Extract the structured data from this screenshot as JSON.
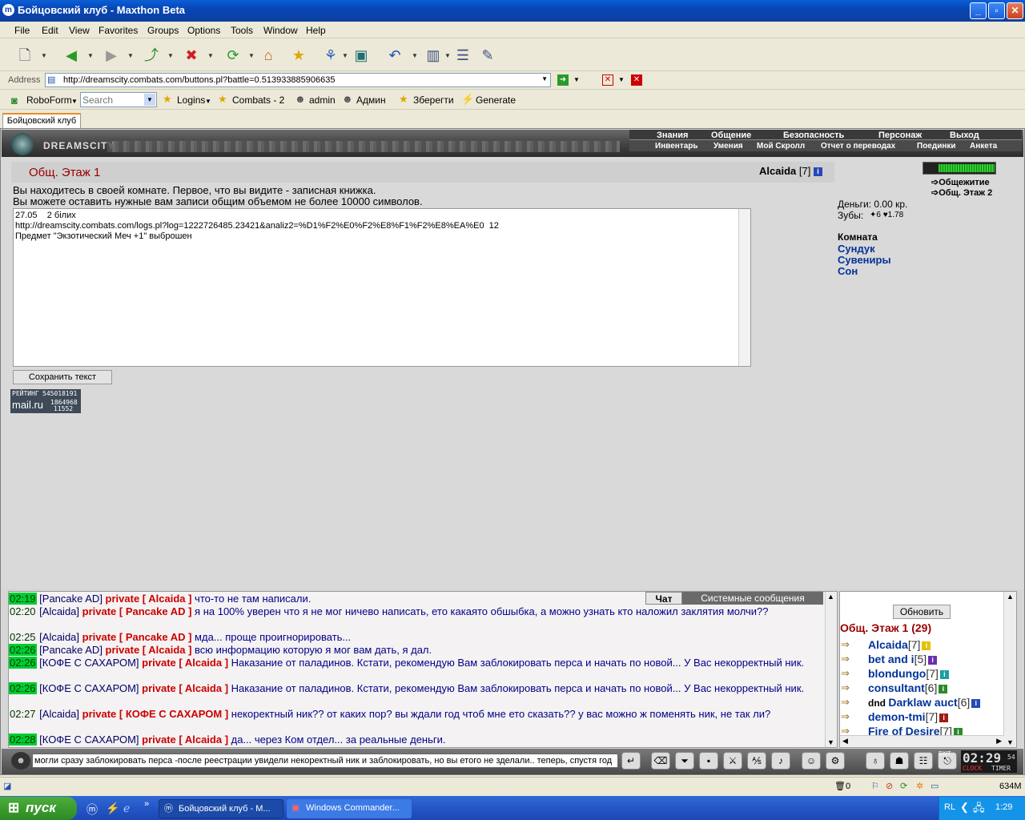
{
  "window": {
    "title": "Бойцовский клуб - Maxthon Beta"
  },
  "menu": [
    "File",
    "Edit",
    "View",
    "Favorites",
    "Groups",
    "Options",
    "Tools",
    "Window",
    "Help"
  ],
  "address": {
    "label": "Address",
    "url": "http://dreamscity.combats.com/buttons.pl?battle=0.513933885906635"
  },
  "links": {
    "roboform": "RoboForm",
    "search_placeholder": "Search",
    "logins": "Logins",
    "combats": "Combats - 2",
    "admin": "admin",
    "admin_ru": "Админ",
    "save": "Зберегти",
    "generate": "Generate"
  },
  "tab": {
    "label": "Бойцовский клуб"
  },
  "site": {
    "logo": "DREAMSCITY",
    "nav_top": [
      "Знания",
      "Общение",
      "Безопасность",
      "Персонаж",
      "Выход"
    ],
    "nav_bottom": [
      "Инвентарь",
      "Умения",
      "Мой Скролл",
      "Отчет о переводах",
      "Поединки",
      "Анкета"
    ]
  },
  "room": {
    "title": "Общ. Этаж 1",
    "user": "Alcaida",
    "level": "[7]",
    "intro1": "Вы находитесь в своей комнате. Первое, что вы видите - записная книжка.",
    "intro2": "Вы можете оставить нужные вам записи общим объемом не более 10000 символов.",
    "notes": "27.05    2 білих\nhttp://dreamscity.combats.com/logs.pl?log=1222726485.23421&analiz2=%D1%F2%E0%F2%E8%F1%F2%E8%EA%E0  12\nПредмет \"Экзотический Меч +1\" выброшен",
    "save_button": "Сохранить текст",
    "rating_label": "РЕЙТИНГ",
    "rating_id": "545018191",
    "rating_brand": "mail.ru",
    "rating_n1": "1864968",
    "rating_n2": "11552"
  },
  "sidebar": {
    "links": [
      "Общежитие",
      "Общ. Этаж 2"
    ],
    "money": "Деньги: 0.00 кр.",
    "teeth_label": "Зубы:",
    "teeth_v1": "6",
    "teeth_v2": "1.78",
    "section": "Комната",
    "room_links": [
      "Сундук",
      "Сувениры",
      "Сон"
    ]
  },
  "chat": {
    "tabs": [
      "Чат",
      "Системные сообщения"
    ],
    "messages": [
      {
        "time": "02:19",
        "hl": true,
        "from": "[Pancake AD]",
        "priv": "private [ Alcaida ]",
        "text": "что-то не там написали."
      },
      {
        "time": "02:20",
        "hl": false,
        "from": "[Alcaida]",
        "priv": "private [ Pancake AD ]",
        "text": "я на 100% уверен что я не мог ничево написать, ето какаято обшыбка, а можно узнать кто наложил заклятия молчи??"
      },
      {
        "time": "02:25",
        "hl": false,
        "from": "[Alcaida]",
        "priv": "private [ Pancake AD ]",
        "text": "мда... проще проигнорировать..."
      },
      {
        "time": "02:26",
        "hl": true,
        "from": "[Pancake AD]",
        "priv": "private [ Alcaida ]",
        "text": "всю информацию которую я мог вам дать, я дал."
      },
      {
        "time": "02:26",
        "hl": true,
        "from": "[КОФЕ С САХАРОМ]",
        "priv": "private [ Alcaida ]",
        "text": "Наказание от паладинов. Кстати, рекомендую Вам заблокировать перса и начать по новой... У Вас некорректный ник."
      },
      {
        "time": "02:26",
        "hl": true,
        "from": "[КОФЕ С САХАРОМ]",
        "priv": "private [ Alcaida ]",
        "text": "Наказание от паладинов. Кстати, рекомендую Вам заблокировать перса и начать по новой... У Вас некорректный ник."
      },
      {
        "time": "02:27",
        "hl": false,
        "from": "[Alcaida]",
        "priv": "private [ КОФЕ С САХАРОМ ]",
        "text": "некоректный ник?? от каких пор? вы ждали год чтоб мне ето сказать?? у вас можно ж поменять ник, не так ли?"
      },
      {
        "time": "02:28",
        "hl": true,
        "from": "[КОФЕ С САХАРОМ]",
        "priv": "private [ Alcaida ]",
        "text": "да... через Ком отдел... за реальные деньги."
      }
    ],
    "input": "могли сразу заблокировать перса -после реестрации увидели некоректный ник и заблокировать, но вы етого не зделали.. теперь, спустя год"
  },
  "online": {
    "refresh": "Обновить",
    "title": "Общ. Этаж 1 (29)",
    "users": [
      {
        "name": "Alcaida",
        "lvl": "[7]",
        "badge": "#e8c000"
      },
      {
        "name": "bet and i",
        "lvl": "[5]",
        "badge": "#6a2fb0"
      },
      {
        "name": "blondungo",
        "lvl": "[7]",
        "badge": "#1aa0a0"
      },
      {
        "name": "consultant",
        "lvl": "[6]",
        "badge": "#2a8a2a"
      },
      {
        "name": "Darklaw auct",
        "lvl": "[6]",
        "badge": "#2748b8",
        "prefix": "dnd"
      },
      {
        "name": "demon-tmi",
        "lvl": "[7]",
        "badge": "#a01818"
      },
      {
        "name": "Fire of Desire",
        "lvl": "[7]",
        "badge": "#2a8a2a"
      }
    ]
  },
  "clock": {
    "time": "02:29",
    "sub": "54",
    "clock_label": "CLOCK",
    "timer_label": "TIMER",
    "exit": "EXIT"
  },
  "statusbar": {
    "count": "0",
    "mem": "634M"
  },
  "taskbar": {
    "start": "пуск",
    "tasks": [
      "Бойцовский клуб - M...",
      "Windows Commander..."
    ],
    "lang": "RL",
    "time": "1:29"
  }
}
